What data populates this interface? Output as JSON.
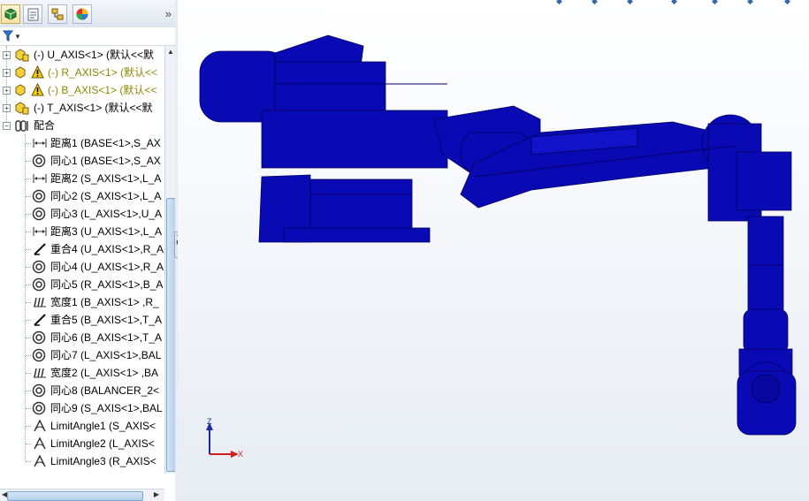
{
  "tabs": [
    {
      "id": "feature-manager",
      "icon": "feature-manager-icon"
    },
    {
      "id": "property-manager",
      "icon": "property-manager-icon"
    },
    {
      "id": "configuration-manager",
      "icon": "configuration-manager-icon"
    },
    {
      "id": "display-manager",
      "icon": "display-manager-icon"
    }
  ],
  "tabs_more": "»",
  "tree": {
    "components": [
      {
        "label": "(-) U_AXIS<1> (默认<<默",
        "warning": false
      },
      {
        "label": "(-) R_AXIS<1> (默认<<",
        "warning": true
      },
      {
        "label": "(-) B_AXIS<1> (默认<<",
        "warning": true
      },
      {
        "label": "(-) T_AXIS<1> (默认<<默",
        "warning": false
      }
    ],
    "mates_folder": "配合",
    "mates": [
      {
        "type": "distance",
        "label": "距离1 (BASE<1>,S_AX"
      },
      {
        "type": "concentric",
        "label": "同心1 (BASE<1>,S_AX"
      },
      {
        "type": "distance",
        "label": "距离2 (S_AXIS<1>,L_A"
      },
      {
        "type": "concentric",
        "label": "同心2 (S_AXIS<1>,L_A"
      },
      {
        "type": "concentric",
        "label": "同心3 (L_AXIS<1>,U_A"
      },
      {
        "type": "distance",
        "label": "距离3 (U_AXIS<1>,L_A"
      },
      {
        "type": "coincident",
        "label": "重合4 (U_AXIS<1>,R_A"
      },
      {
        "type": "concentric",
        "label": "同心4 (U_AXIS<1>,R_A"
      },
      {
        "type": "concentric",
        "label": "同心5 (R_AXIS<1>,B_A"
      },
      {
        "type": "width",
        "label": "宽度1 (B_AXIS<1> ,R_"
      },
      {
        "type": "coincident",
        "label": "重合5 (B_AXIS<1>,T_A"
      },
      {
        "type": "concentric",
        "label": "同心6 (B_AXIS<1>,T_A"
      },
      {
        "type": "concentric",
        "label": "同心7 (L_AXIS<1>,BAL"
      },
      {
        "type": "width",
        "label": "宽度2 (L_AXIS<1> ,BA"
      },
      {
        "type": "concentric",
        "label": "同心8 (BALANCER_2<"
      },
      {
        "type": "concentric",
        "label": "同心9 (S_AXIS<1>,BAL"
      },
      {
        "type": "angle",
        "label": "LimitAngle1 (S_AXIS<"
      },
      {
        "type": "angle",
        "label": "LimitAngle2 (L_AXIS<"
      },
      {
        "type": "angle",
        "label": "LimitAngle3 (R_AXIS<"
      }
    ]
  },
  "viewport": {
    "model_color": "#0a0ab4",
    "triad": {
      "z": "Z",
      "x": "X"
    }
  },
  "colors": {
    "warning": "#8a8a00",
    "model": "#0a0ab4",
    "triad_z": "#1b2a9e",
    "triad_x": "#d21c1c"
  }
}
